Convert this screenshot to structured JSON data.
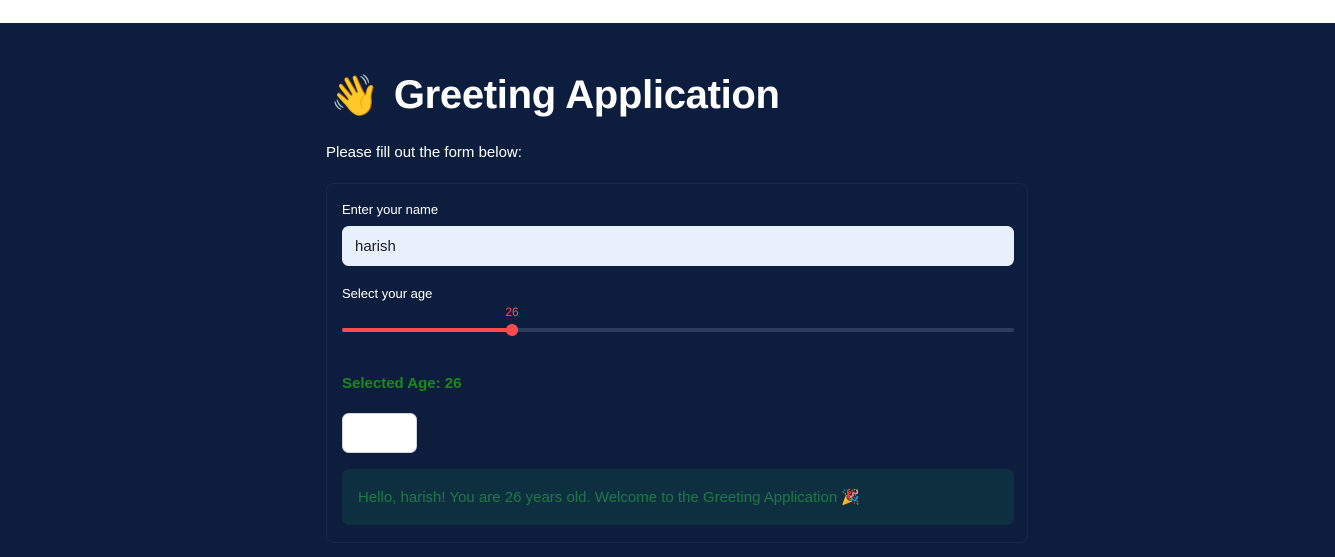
{
  "header": {
    "icon": "waving-hand-icon",
    "icon_glyph": "👋",
    "title": "Greeting Application"
  },
  "subtitle": "Please fill out the form below:",
  "form": {
    "name_label": "Enter your name",
    "name_value": "harish",
    "age_label": "Select your age",
    "age_value": "26",
    "age_fraction": 0.25,
    "selected_age_text": "Selected Age: 26",
    "submit_label": "",
    "success_message": "Hello, harish! You are 26 years old. Welcome to the Greeting Application 🎉"
  },
  "colors": {
    "background": "#0c1d3e",
    "accent": "#ff4b4b",
    "success_text": "#1a8a1a"
  }
}
